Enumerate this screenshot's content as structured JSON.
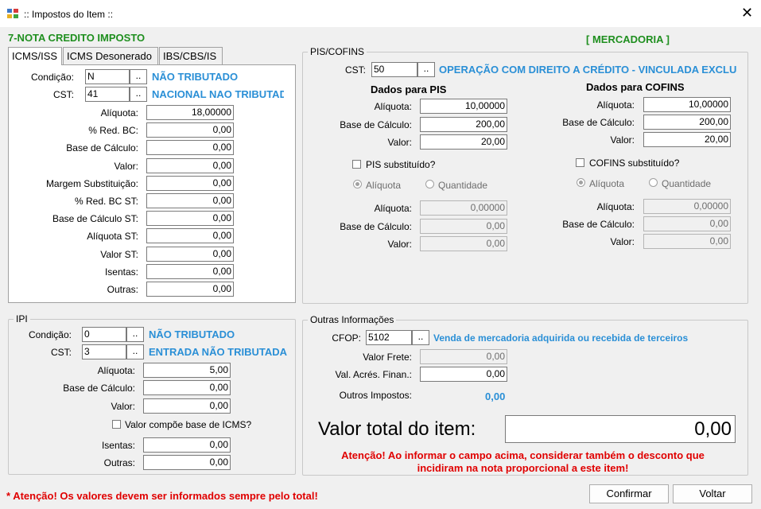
{
  "window": {
    "title": ":: Impostos do Item ::",
    "close_glyph": "✕"
  },
  "header": {
    "nota": "7-NOTA CREDITO IMPOSTO",
    "tipo": "[ MERCADORIA ]"
  },
  "tabs": [
    "ICMS/ISS",
    "ICMS Desonerado",
    "IBS/CBS/IS"
  ],
  "icms": {
    "condicao": {
      "label": "Condição:",
      "value": "N",
      "desc": "NÃO TRIBUTADO"
    },
    "cst": {
      "label": "CST:",
      "value": "41",
      "desc": "NACIONAL NAO TRIBUTADA"
    },
    "fields": [
      {
        "label": "Alíquota:",
        "value": "18,00000"
      },
      {
        "label": "% Red. BC:",
        "value": "0,00"
      },
      {
        "label": "Base de Cálculo:",
        "value": "0,00"
      },
      {
        "label": "Valor:",
        "value": "0,00"
      },
      {
        "label": "Margem Substituição:",
        "value": "0,00"
      },
      {
        "label": "% Red. BC ST:",
        "value": "0,00"
      },
      {
        "label": "Base de Cálculo ST:",
        "value": "0,00"
      },
      {
        "label": "Alíquota ST:",
        "value": "0,00"
      },
      {
        "label": "Valor ST:",
        "value": "0,00"
      },
      {
        "label": "Isentas:",
        "value": "0,00"
      },
      {
        "label": "Outras:",
        "value": "0,00"
      }
    ]
  },
  "pis_cofins": {
    "title": "PIS/COFINS",
    "cst": {
      "label": "CST:",
      "value": "50",
      "desc": "OPERAÇÃO COM DIREITO A CRÉDITO - VINCULADA EXCLUSIVAMENTE"
    },
    "pis": {
      "title": "Dados para PIS",
      "aliquota": {
        "label": "Alíquota:",
        "value": "10,00000"
      },
      "base": {
        "label": "Base de Cálculo:",
        "value": "200,00"
      },
      "valor": {
        "label": "Valor:",
        "value": "20,00"
      },
      "substituido": "PIS substituído?",
      "radio_aliquota": "Alíquota",
      "radio_quantidade": "Quantidade",
      "st_aliquota": {
        "label": "Alíquota:",
        "value": "0,00000"
      },
      "st_base": {
        "label": "Base de Cálculo:",
        "value": "0,00"
      },
      "st_valor": {
        "label": "Valor:",
        "value": "0,00"
      }
    },
    "cofins": {
      "title": "Dados para COFINS",
      "aliquota": {
        "label": "Alíquota:",
        "value": "10,00000"
      },
      "base": {
        "label": "Base de Cálculo:",
        "value": "200,00"
      },
      "valor": {
        "label": "Valor:",
        "value": "20,00"
      },
      "substituido": "COFINS substituído?",
      "radio_aliquota": "Alíquota",
      "radio_quantidade": "Quantidade",
      "st_aliquota": {
        "label": "Alíquota:",
        "value": "0,00000"
      },
      "st_base": {
        "label": "Base de Cálculo:",
        "value": "0,00"
      },
      "st_valor": {
        "label": "Valor:",
        "value": "0,00"
      }
    }
  },
  "ipi": {
    "title": "IPI",
    "condicao": {
      "label": "Condição:",
      "value": "0",
      "desc": "NÃO TRIBUTADO"
    },
    "cst": {
      "label": "CST:",
      "value": "3",
      "desc": "ENTRADA NÃO TRIBUTADA"
    },
    "aliquota": {
      "label": "Alíquota:",
      "value": "5,00"
    },
    "base": {
      "label": "Base de Cálculo:",
      "value": "0,00"
    },
    "valor": {
      "label": "Valor:",
      "value": "0,00"
    },
    "compoe": "Valor compõe base de ICMS?",
    "isentas": {
      "label": "Isentas:",
      "value": "0,00"
    },
    "outras": {
      "label": "Outras:",
      "value": "0,00"
    }
  },
  "outras": {
    "title": "Outras Informações",
    "cfop": {
      "label": "CFOP:",
      "value": "5102",
      "desc": "Venda de mercadoria adquirida ou recebida de terceiros"
    },
    "frete": {
      "label": "Valor Frete:",
      "value": "0,00"
    },
    "acres": {
      "label": "Val. Acrés. Finan.:",
      "value": "0,00"
    },
    "outros_impostos": {
      "label": "Outros Impostos:",
      "value": "0,00"
    },
    "total": {
      "label": "Valor total do item:",
      "value": "0,00"
    },
    "atencao": "Atenção! Ao informar o campo acima, considerar também o desconto que incidiram na nota proporcional a este item!"
  },
  "footer": {
    "warning": "* Atenção! Os valores devem ser informados sempre pelo total!",
    "confirm": "Confirmar",
    "back": "Voltar"
  },
  "ellipsis": ".."
}
